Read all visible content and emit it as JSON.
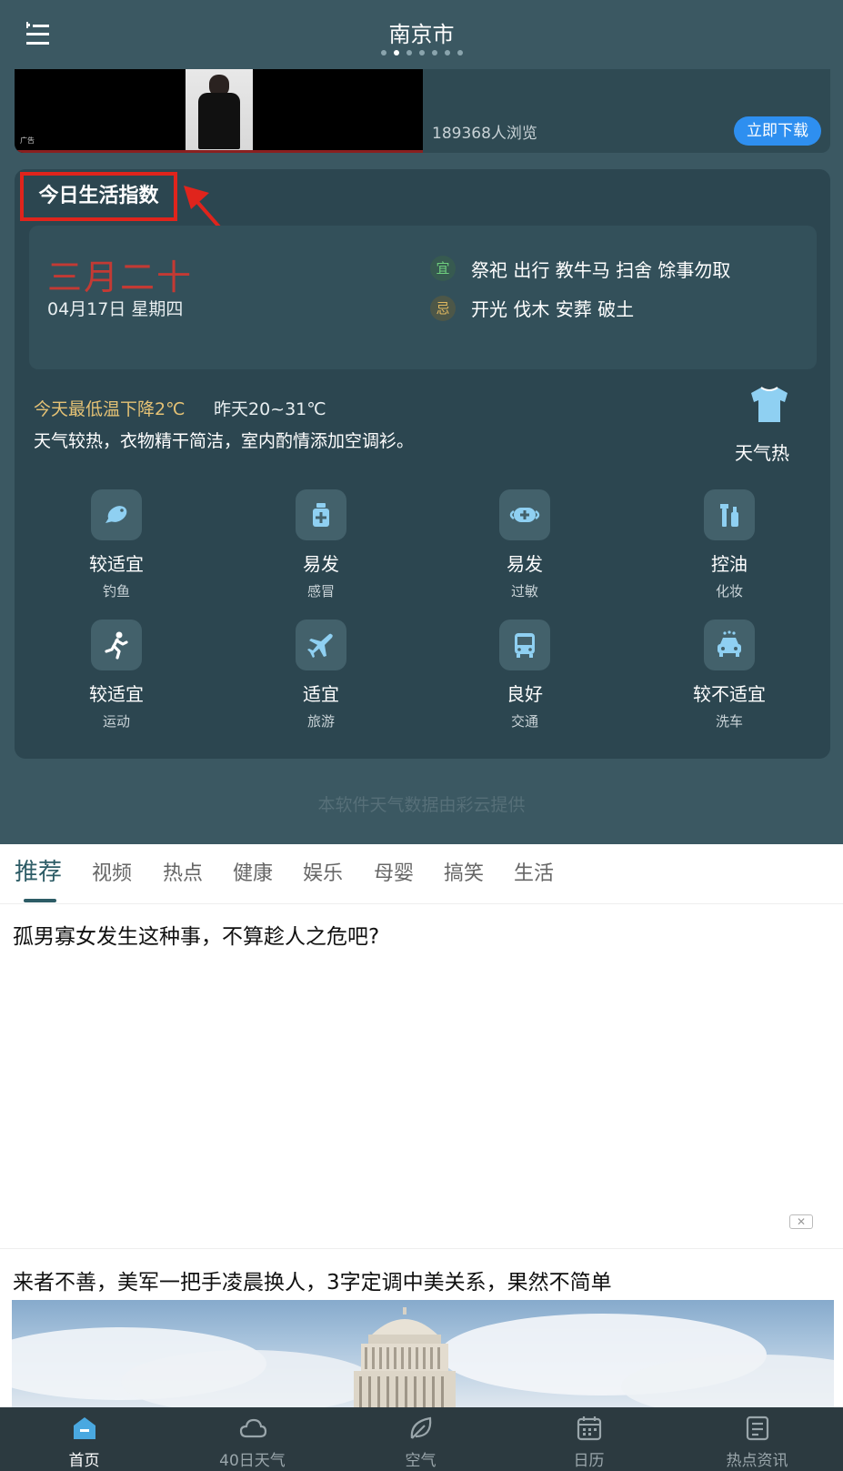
{
  "header": {
    "city": "南京市",
    "page_count": 7,
    "active_page": 1
  },
  "ad_banner": {
    "tag": "广告",
    "views": "189368人浏览",
    "download_label": "立即下载"
  },
  "life_index": {
    "title": "今日生活指数",
    "lunar_date": "三月二十",
    "solar_date": "04月17日 星期四",
    "yi_badge": "宜",
    "yi_text": "祭祀 出行 教牛马 扫舍 馀事勿取",
    "ji_badge": "忌",
    "ji_text": "开光 伐木 安葬 破土",
    "temp_drop": "今天最低温下降2℃",
    "yesterday": "昨天20~31℃",
    "clothing_tip": "天气较热，衣物精干简洁，室内酌情添加空调衫。",
    "clothing_label": "天气热",
    "items": [
      {
        "value": "较适宜",
        "category": "钓鱼",
        "icon": "fishing-icon"
      },
      {
        "value": "易发",
        "category": "感冒",
        "icon": "medicine-icon"
      },
      {
        "value": "易发",
        "category": "过敏",
        "icon": "mask-icon"
      },
      {
        "value": "控油",
        "category": "化妆",
        "icon": "cosmetics-icon"
      },
      {
        "value": "较适宜",
        "category": "运动",
        "icon": "running-icon"
      },
      {
        "value": "适宜",
        "category": "旅游",
        "icon": "airplane-icon"
      },
      {
        "value": "良好",
        "category": "交通",
        "icon": "bus-icon"
      },
      {
        "value": "较不适宜",
        "category": "洗车",
        "icon": "car-wash-icon"
      }
    ],
    "data_credit": "本软件天气数据由彩云提供"
  },
  "news": {
    "tabs": [
      "推荐",
      "视频",
      "热点",
      "健康",
      "娱乐",
      "母婴",
      "搞笑",
      "生活"
    ],
    "active_tab": 0,
    "articles": [
      {
        "title": "孤男寡女发生这种事，不算趁人之危吧?"
      },
      {
        "title": "来者不善，美军一把手凌晨换人，3字定调中美关系，果然不简单"
      }
    ]
  },
  "bottom_nav": {
    "items": [
      {
        "label": "首页",
        "icon": "home-icon"
      },
      {
        "label": "40日天气",
        "icon": "cloud-icon"
      },
      {
        "label": "空气",
        "icon": "leaf-icon"
      },
      {
        "label": "日历",
        "icon": "calendar-icon"
      },
      {
        "label": "热点资讯",
        "icon": "news-icon"
      }
    ],
    "active": 0
  },
  "colors": {
    "weather_bg": "#3b5862",
    "card_bg": "#2c4650",
    "highlight_box": "#e0241c",
    "download_button": "#2e8ff0",
    "accent_tab": "#2d5c66",
    "nav_bg": "#2c3a40"
  }
}
